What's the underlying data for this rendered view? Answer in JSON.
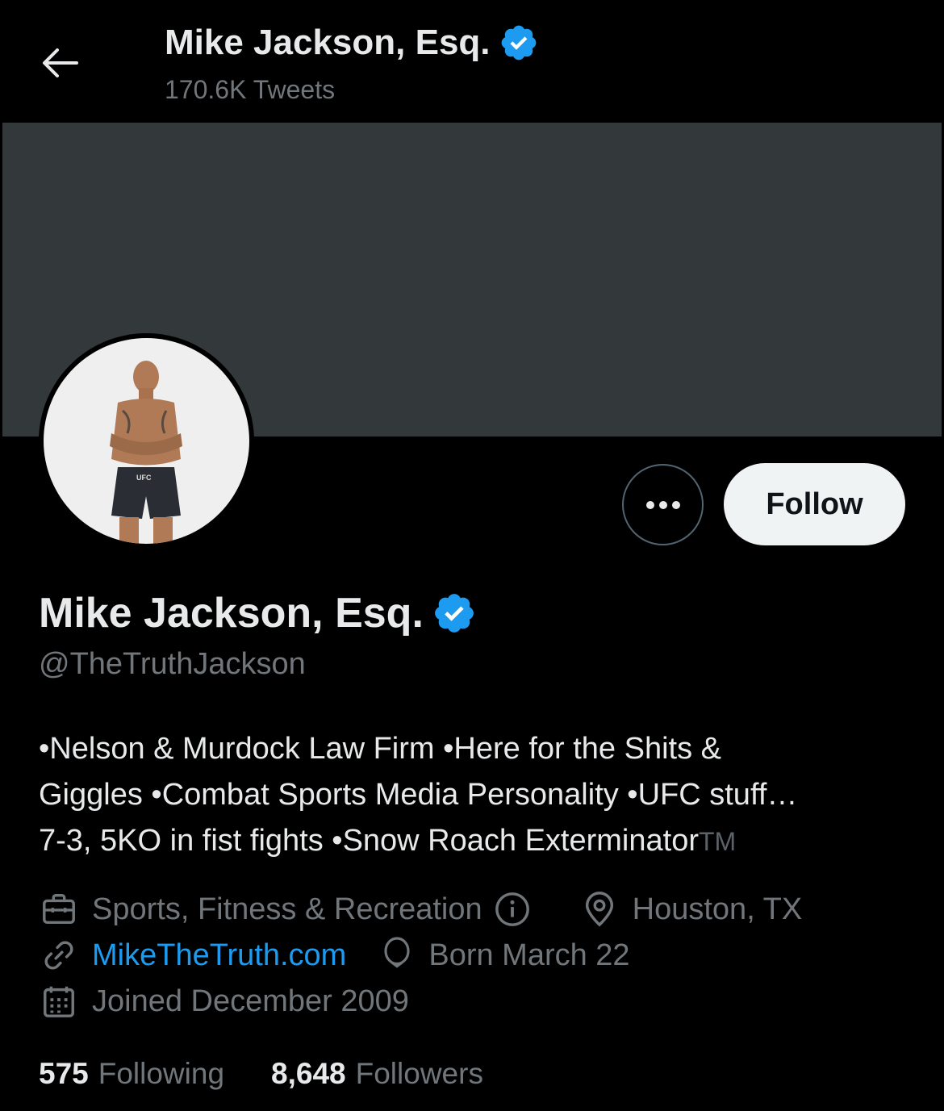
{
  "header": {
    "title": "Mike Jackson, Esq.",
    "tweet_count": "170.6K Tweets"
  },
  "profile": {
    "name": "Mike Jackson, Esq.",
    "handle": "@TheTruthJackson",
    "verified": true,
    "bio_lines": [
      "•Nelson & Murdock Law Firm •Here for the Shits &",
      "Giggles •Combat Sports Media Personality •UFC stuff…",
      "7-3, 5KO in fist fights •Snow Roach Exterminator"
    ],
    "bio_tm": "TM",
    "category": "Sports, Fitness & Recreation",
    "location": "Houston, TX",
    "website": "MikeTheTruth.com",
    "birthday": "Born March 22",
    "joined": "Joined December 2009",
    "following_count": "575",
    "following_label": "Following",
    "followers_count": "8,648",
    "followers_label": "Followers"
  },
  "actions": {
    "follow_label": "Follow"
  },
  "colors": {
    "background": "#000000",
    "banner": "#33383b",
    "verified_blue": "#1d9bf0",
    "link_blue": "#1d9bf0",
    "secondary_text": "#71767b",
    "follow_button_bg": "#eff3f4"
  },
  "icons": [
    "back-arrow-icon",
    "verified-badge-icon",
    "more-dots-icon",
    "briefcase-icon",
    "info-icon",
    "location-pin-icon",
    "link-icon",
    "balloon-icon",
    "calendar-icon"
  ]
}
